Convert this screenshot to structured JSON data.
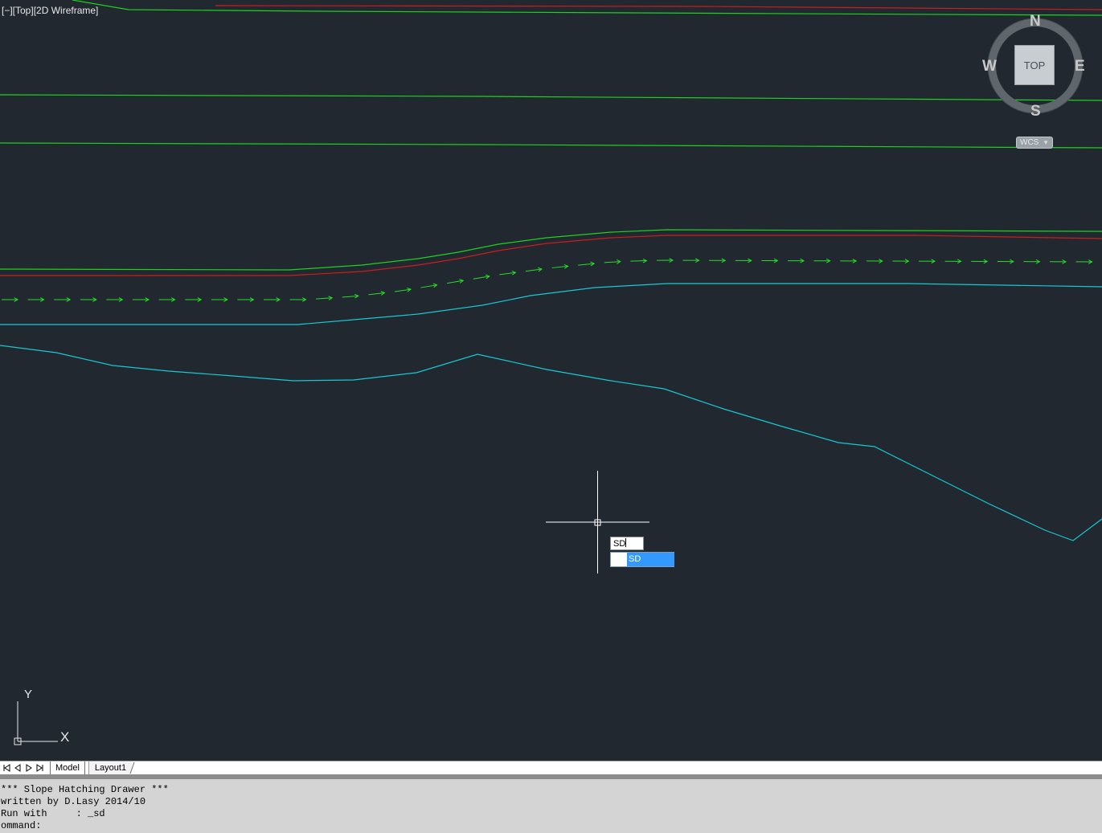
{
  "viewport": {
    "label": "[−][Top][2D Wireframe]"
  },
  "colors": {
    "background": "#212830",
    "green": "#1ed21e",
    "red": "#c81e1e",
    "cyan": "#19c8d2",
    "arrows": "#28dc28"
  },
  "viewcube": {
    "north": "N",
    "south": "S",
    "east": "E",
    "west": "W",
    "face": "TOP",
    "coordinate_system": "WCS"
  },
  "ucs_icon": {
    "x_label": "X",
    "y_label": "Y"
  },
  "dynamic_input": {
    "value": "SD",
    "suggestion": "SD"
  },
  "layout_tabs": {
    "model": "Model",
    "layout1": "Layout1"
  },
  "command_history": {
    "lines": [
      "*** Slope Hatching Drawer ***",
      "written by D.Lasy 2014/10",
      "Run with     : _sd",
      "ommand:"
    ]
  }
}
